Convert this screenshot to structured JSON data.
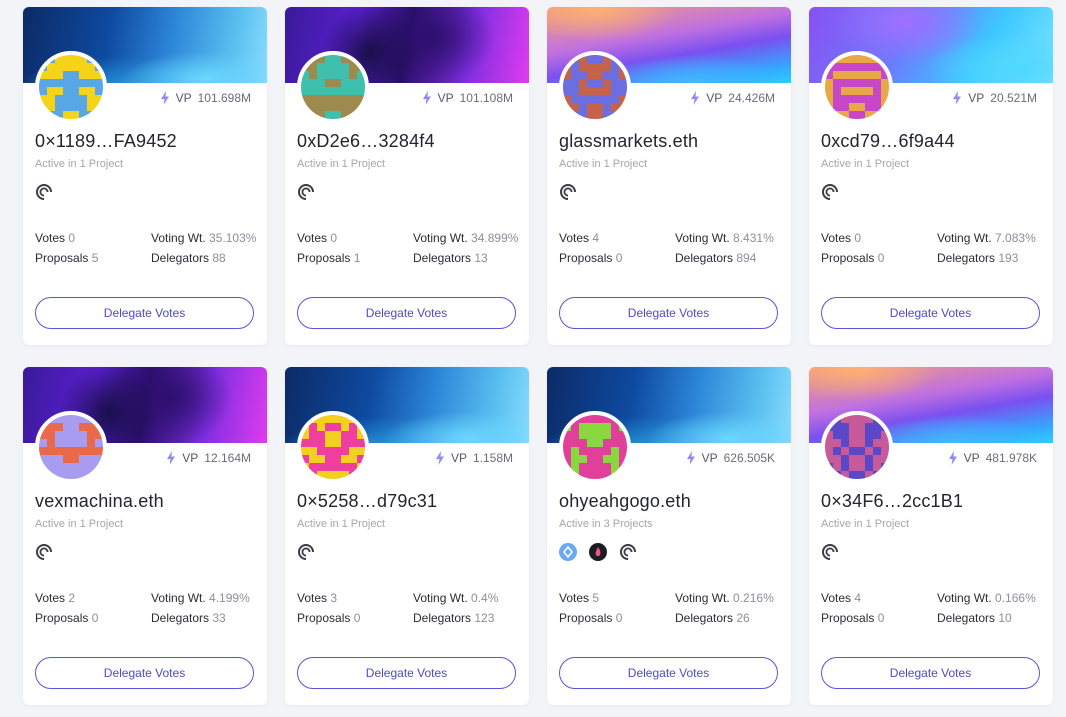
{
  "delegates": [
    {
      "name": "0×1189…FA9452",
      "vp_label": "VP",
      "vp": "101.698M",
      "active": "Active in 1 Project",
      "votes_label": "Votes",
      "votes": "0",
      "wt_label": "Voting Wt.",
      "voting_weight": "35.103%",
      "proposals_label": "Proposals",
      "proposals": "5",
      "delegators_label": "Delegators",
      "delegators": "88",
      "button": "Delegate Votes",
      "projects": [
        "project-icon"
      ],
      "banner": "b1",
      "avatar_colors": [
        "#f5d317",
        "#5aa7e8"
      ]
    },
    {
      "name": "0xD2e6…3284f4",
      "vp_label": "VP",
      "vp": "101.108M",
      "active": "Active in 1 Project",
      "votes_label": "Votes",
      "votes": "0",
      "wt_label": "Voting Wt.",
      "voting_weight": "34.899%",
      "proposals_label": "Proposals",
      "proposals": "1",
      "delegators_label": "Delegators",
      "delegators": "13",
      "button": "Delegate Votes",
      "projects": [
        "project-icon"
      ],
      "banner": "b2",
      "avatar_colors": [
        "#3fbfae",
        "#9e8a4c"
      ]
    },
    {
      "name": "glassmarkets.eth",
      "vp_label": "VP",
      "vp": "24.426M",
      "active": "Active in 1 Project",
      "votes_label": "Votes",
      "votes": "4",
      "wt_label": "Voting Wt.",
      "voting_weight": "8.431%",
      "proposals_label": "Proposals",
      "proposals": "0",
      "delegators_label": "Delegators",
      "delegators": "894",
      "button": "Delegate Votes",
      "projects": [
        "project-icon"
      ],
      "banner": "b3",
      "avatar_colors": [
        "#6a6ee0",
        "#c4624a"
      ]
    },
    {
      "name": "0xcd79…6f9a44",
      "vp_label": "VP",
      "vp": "20.521M",
      "active": "Active in 1 Project",
      "votes_label": "Votes",
      "votes": "0",
      "wt_label": "Voting Wt.",
      "voting_weight": "7.083%",
      "proposals_label": "Proposals",
      "proposals": "0",
      "delegators_label": "Delegators",
      "delegators": "193",
      "button": "Delegate Votes",
      "projects": [
        "project-icon"
      ],
      "banner": "b4",
      "avatar_colors": [
        "#e8a848",
        "#c846c8"
      ]
    },
    {
      "name": "vexmachina.eth",
      "vp_label": "VP",
      "vp": "12.164M",
      "active": "Active in 1 Project",
      "votes_label": "Votes",
      "votes": "2",
      "wt_label": "Voting Wt.",
      "voting_weight": "4.199%",
      "proposals_label": "Proposals",
      "proposals": "0",
      "delegators_label": "Delegators",
      "delegators": "33",
      "button": "Delegate Votes",
      "projects": [
        "project-icon"
      ],
      "banner": "b2",
      "avatar_colors": [
        "#a89cf0",
        "#e86a4a"
      ]
    },
    {
      "name": "0×5258…d79c31",
      "vp_label": "VP",
      "vp": "1.158M",
      "active": "Active in 1 Project",
      "votes_label": "Votes",
      "votes": "3",
      "wt_label": "Voting Wt.",
      "voting_weight": "0.4%",
      "proposals_label": "Proposals",
      "proposals": "0",
      "delegators_label": "Delegators",
      "delegators": "123",
      "button": "Delegate Votes",
      "projects": [
        "project-icon"
      ],
      "banner": "b1",
      "avatar_colors": [
        "#f03ea0",
        "#f2d020"
      ]
    },
    {
      "name": "ohyeahgogo.eth",
      "vp_label": "VP",
      "vp": "626.505K",
      "active": "Active in 3 Projects",
      "votes_label": "Votes",
      "votes": "5",
      "wt_label": "Voting Wt.",
      "voting_weight": "0.216%",
      "proposals_label": "Proposals",
      "proposals": "0",
      "delegators_label": "Delegators",
      "delegators": "26",
      "button": "Delegate Votes",
      "projects": [
        "diamond-project-icon",
        "flame-project-icon",
        "project-icon"
      ],
      "banner": "b1",
      "avatar_colors": [
        "#8ad840",
        "#e0409a"
      ]
    },
    {
      "name": "0×34F6…2cc1B1",
      "vp_label": "VP",
      "vp": "481.978K",
      "active": "Active in 1 Project",
      "votes_label": "Votes",
      "votes": "4",
      "wt_label": "Voting Wt.",
      "voting_weight": "0.166%",
      "proposals_label": "Proposals",
      "proposals": "0",
      "delegators_label": "Delegators",
      "delegators": "10",
      "button": "Delegate Votes",
      "projects": [
        "project-icon"
      ],
      "banner": "b3",
      "avatar_colors": [
        "#5a48c8",
        "#c85a9a"
      ]
    }
  ]
}
